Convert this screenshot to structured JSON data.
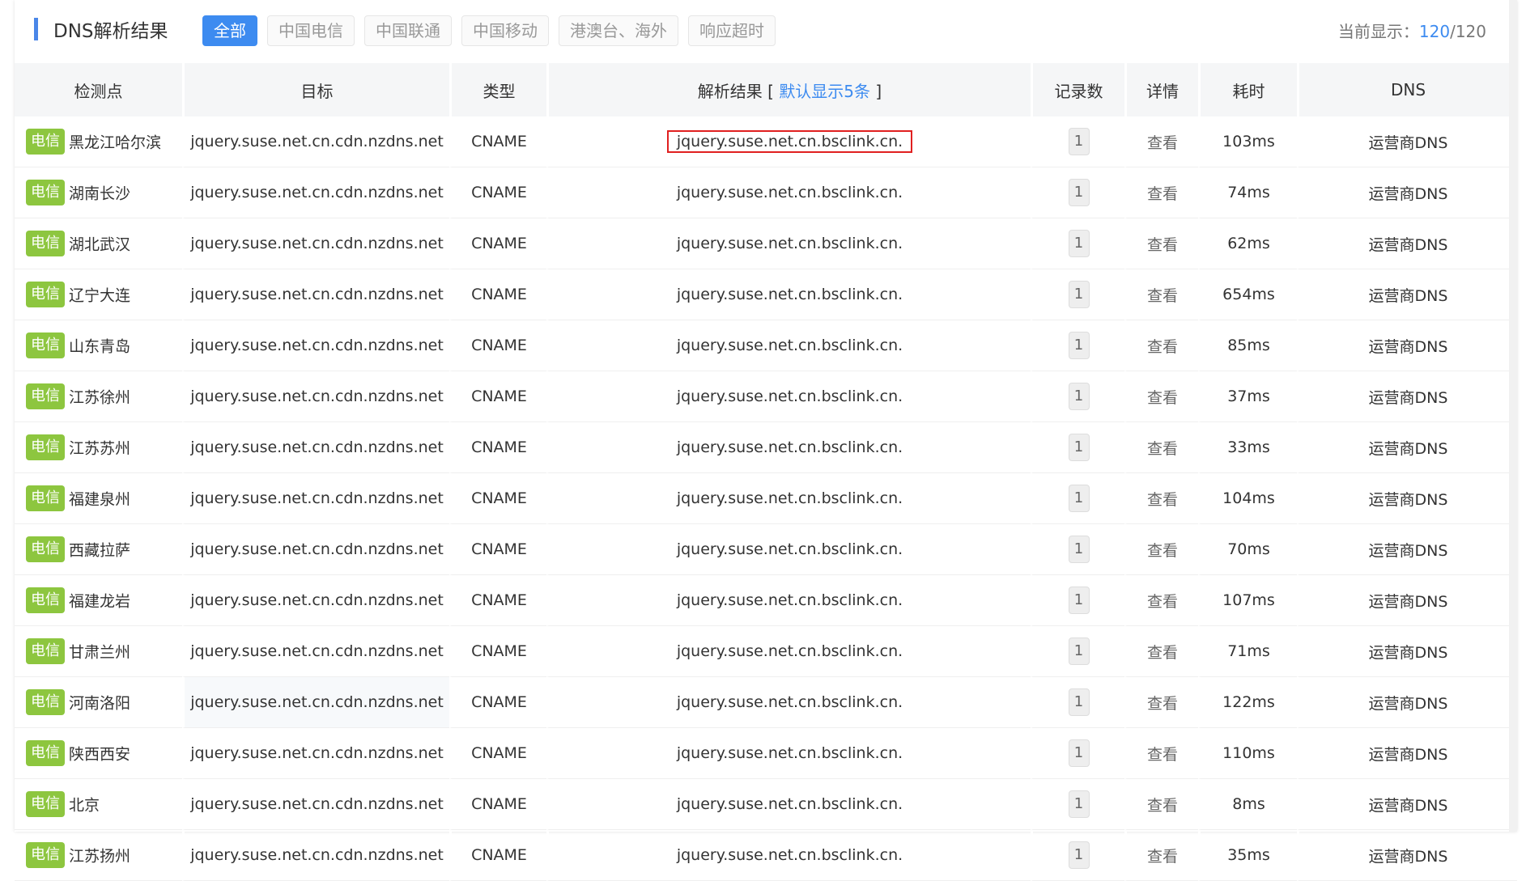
{
  "header": {
    "title": "DNS解析结果",
    "filters": [
      "全部",
      "中国电信",
      "中国联通",
      "中国移动",
      "港澳台、海外",
      "响应超时"
    ],
    "count_label": "当前显示：",
    "count_current": "120",
    "count_sep": "/",
    "count_total": "120"
  },
  "table": {
    "columns": {
      "probe": "检测点",
      "target": "目标",
      "type": "类型",
      "result_prefix": "解析结果 [ ",
      "result_link": "默认显示5条",
      "result_suffix": " ]",
      "records": "记录数",
      "detail": "详情",
      "latency": "耗时",
      "dns": "DNS"
    },
    "rows": [
      {
        "isp": "电信",
        "location": "黑龙江哈尔滨",
        "target": "jquery.suse.net.cn.cdn.nzdns.net",
        "type": "CNAME",
        "result": "jquery.suse.net.cn.bsclink.cn.",
        "records": "1",
        "detail": "查看",
        "latency": "103ms",
        "dns": "运营商DNS"
      },
      {
        "isp": "电信",
        "location": "湖南长沙",
        "target": "jquery.suse.net.cn.cdn.nzdns.net",
        "type": "CNAME",
        "result": "jquery.suse.net.cn.bsclink.cn.",
        "records": "1",
        "detail": "查看",
        "latency": "74ms",
        "dns": "运营商DNS"
      },
      {
        "isp": "电信",
        "location": "湖北武汉",
        "target": "jquery.suse.net.cn.cdn.nzdns.net",
        "type": "CNAME",
        "result": "jquery.suse.net.cn.bsclink.cn.",
        "records": "1",
        "detail": "查看",
        "latency": "62ms",
        "dns": "运营商DNS"
      },
      {
        "isp": "电信",
        "location": "辽宁大连",
        "target": "jquery.suse.net.cn.cdn.nzdns.net",
        "type": "CNAME",
        "result": "jquery.suse.net.cn.bsclink.cn.",
        "records": "1",
        "detail": "查看",
        "latency": "654ms",
        "dns": "运营商DNS"
      },
      {
        "isp": "电信",
        "location": "山东青岛",
        "target": "jquery.suse.net.cn.cdn.nzdns.net",
        "type": "CNAME",
        "result": "jquery.suse.net.cn.bsclink.cn.",
        "records": "1",
        "detail": "查看",
        "latency": "85ms",
        "dns": "运营商DNS"
      },
      {
        "isp": "电信",
        "location": "江苏徐州",
        "target": "jquery.suse.net.cn.cdn.nzdns.net",
        "type": "CNAME",
        "result": "jquery.suse.net.cn.bsclink.cn.",
        "records": "1",
        "detail": "查看",
        "latency": "37ms",
        "dns": "运营商DNS"
      },
      {
        "isp": "电信",
        "location": "江苏苏州",
        "target": "jquery.suse.net.cn.cdn.nzdns.net",
        "type": "CNAME",
        "result": "jquery.suse.net.cn.bsclink.cn.",
        "records": "1",
        "detail": "查看",
        "latency": "33ms",
        "dns": "运营商DNS"
      },
      {
        "isp": "电信",
        "location": "福建泉州",
        "target": "jquery.suse.net.cn.cdn.nzdns.net",
        "type": "CNAME",
        "result": "jquery.suse.net.cn.bsclink.cn.",
        "records": "1",
        "detail": "查看",
        "latency": "104ms",
        "dns": "运营商DNS"
      },
      {
        "isp": "电信",
        "location": "西藏拉萨",
        "target": "jquery.suse.net.cn.cdn.nzdns.net",
        "type": "CNAME",
        "result": "jquery.suse.net.cn.bsclink.cn.",
        "records": "1",
        "detail": "查看",
        "latency": "70ms",
        "dns": "运营商DNS"
      },
      {
        "isp": "电信",
        "location": "福建龙岩",
        "target": "jquery.suse.net.cn.cdn.nzdns.net",
        "type": "CNAME",
        "result": "jquery.suse.net.cn.bsclink.cn.",
        "records": "1",
        "detail": "查看",
        "latency": "107ms",
        "dns": "运营商DNS"
      },
      {
        "isp": "电信",
        "location": "甘肃兰州",
        "target": "jquery.suse.net.cn.cdn.nzdns.net",
        "type": "CNAME",
        "result": "jquery.suse.net.cn.bsclink.cn.",
        "records": "1",
        "detail": "查看",
        "latency": "71ms",
        "dns": "运营商DNS"
      },
      {
        "isp": "电信",
        "location": "河南洛阳",
        "target": "jquery.suse.net.cn.cdn.nzdns.net",
        "type": "CNAME",
        "result": "jquery.suse.net.cn.bsclink.cn.",
        "records": "1",
        "detail": "查看",
        "latency": "122ms",
        "dns": "运营商DNS"
      },
      {
        "isp": "电信",
        "location": "陕西西安",
        "target": "jquery.suse.net.cn.cdn.nzdns.net",
        "type": "CNAME",
        "result": "jquery.suse.net.cn.bsclink.cn.",
        "records": "1",
        "detail": "查看",
        "latency": "110ms",
        "dns": "运营商DNS"
      },
      {
        "isp": "电信",
        "location": "北京",
        "target": "jquery.suse.net.cn.cdn.nzdns.net",
        "type": "CNAME",
        "result": "jquery.suse.net.cn.bsclink.cn.",
        "records": "1",
        "detail": "查看",
        "latency": "8ms",
        "dns": "运营商DNS"
      },
      {
        "isp": "电信",
        "location": "江苏扬州",
        "target": "jquery.suse.net.cn.cdn.nzdns.net",
        "type": "CNAME",
        "result": "jquery.suse.net.cn.bsclink.cn.",
        "records": "1",
        "detail": "查看",
        "latency": "35ms",
        "dns": "运营商DNS"
      }
    ]
  },
  "colors": {
    "accent": "#3d8bf0",
    "isp_badge": "#8dc63f",
    "highlight_box": "#e02020"
  }
}
